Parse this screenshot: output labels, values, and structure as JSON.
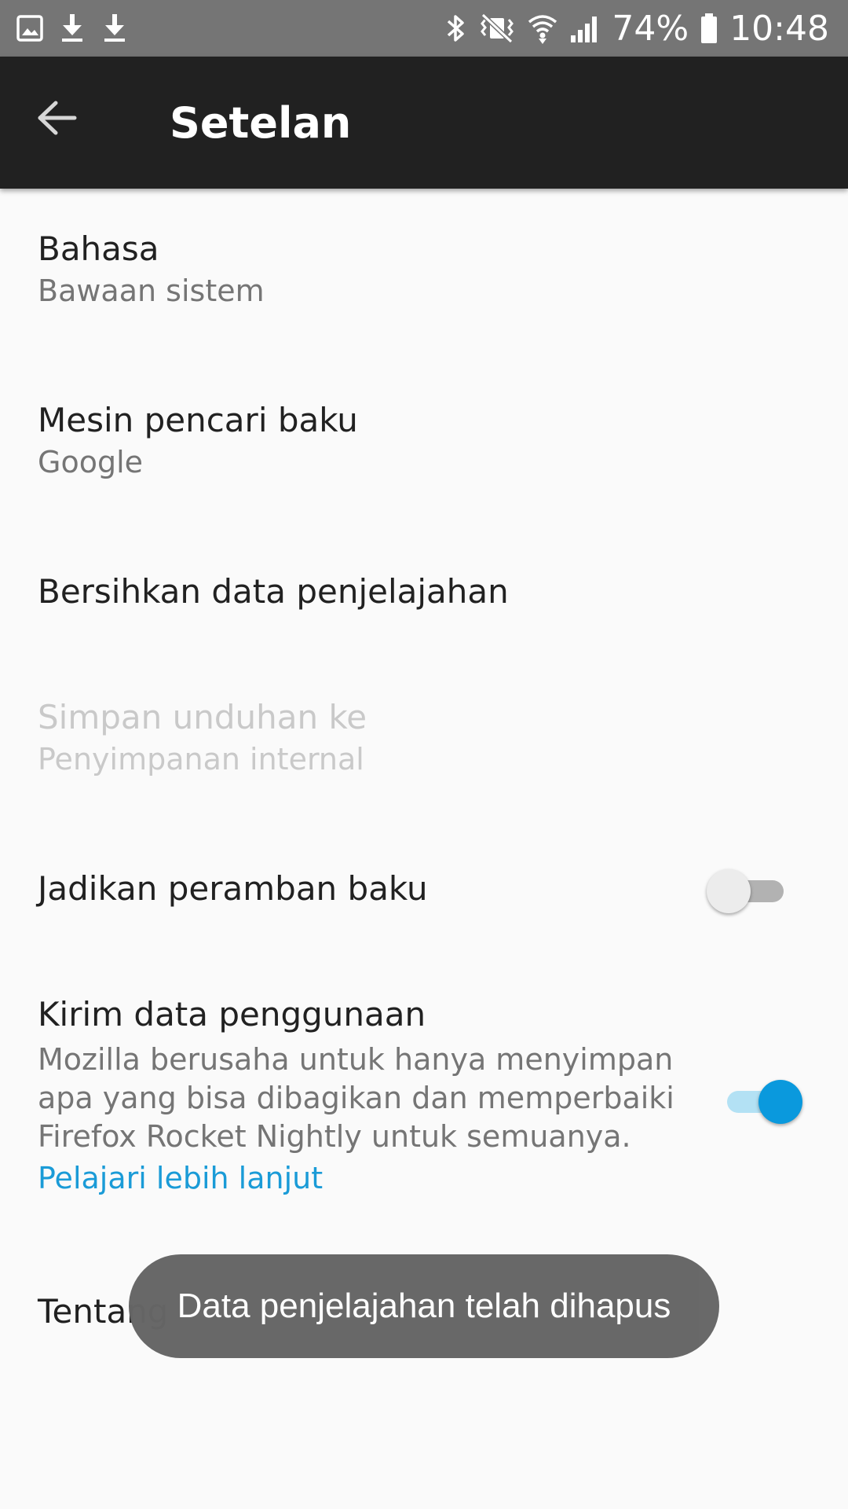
{
  "status_bar": {
    "icons_left": [
      "image-icon",
      "download-icon",
      "download-icon"
    ],
    "icons_right": [
      "bluetooth-icon",
      "vibrate-icon",
      "wifi-icon",
      "signal-icon",
      "battery-icon"
    ],
    "battery_percent": "74%",
    "time": "10:48",
    "background_color": "#757575"
  },
  "app_bar": {
    "back_icon": "arrow-back-icon",
    "title": "Setelan",
    "background_color": "#212121"
  },
  "settings": {
    "language": {
      "title": "Bahasa",
      "summary": "Bawaan sistem"
    },
    "search_engine": {
      "title": "Mesin pencari baku",
      "summary": "Google"
    },
    "clear_data": {
      "title": "Bersihkan data penjelajahan"
    },
    "download_location": {
      "title": "Simpan unduhan ke",
      "summary": "Penyimpanan internal",
      "enabled": false
    },
    "default_browser": {
      "title": "Jadikan peramban baku",
      "switch_on": false
    },
    "telemetry": {
      "title": "Kirim data penggunaan",
      "description": "Mozilla berusaha untuk hanya menyimpan apa yang bisa dibagikan dan memperbaiki Firefox Rocket Nightly untuk semuanya.",
      "link": "Pelajari lebih lanjut",
      "switch_on": true,
      "accent_color": "#0a99dd"
    },
    "about": {
      "title": "Tentang"
    }
  },
  "toast": {
    "message": "Data penjelajahan telah dihapus"
  }
}
